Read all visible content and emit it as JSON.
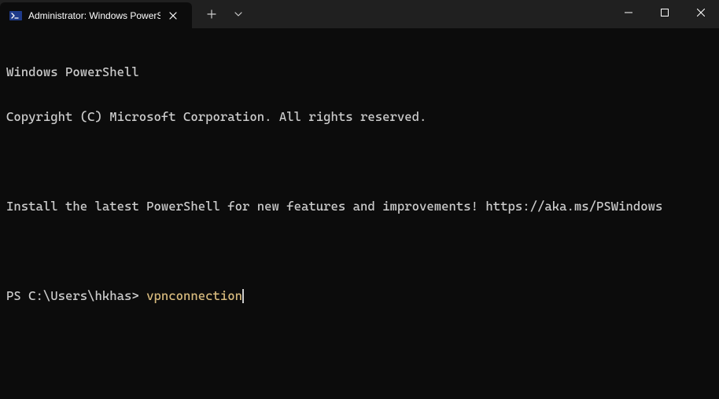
{
  "tab": {
    "title": "Administrator: Windows PowerS"
  },
  "terminal": {
    "line1": "Windows PowerShell",
    "line2": "Copyright (C) Microsoft Corporation. All rights reserved.",
    "line3": "Install the latest PowerShell for new features and improvements! https://aka.ms/PSWindows",
    "prompt": "PS C:\\Users\\hkhas> ",
    "command": "vpnconnection"
  },
  "colors": {
    "command": "#d7ba7d",
    "text": "#cccccc",
    "background": "#0c0c0c",
    "titlebar": "#202020"
  }
}
